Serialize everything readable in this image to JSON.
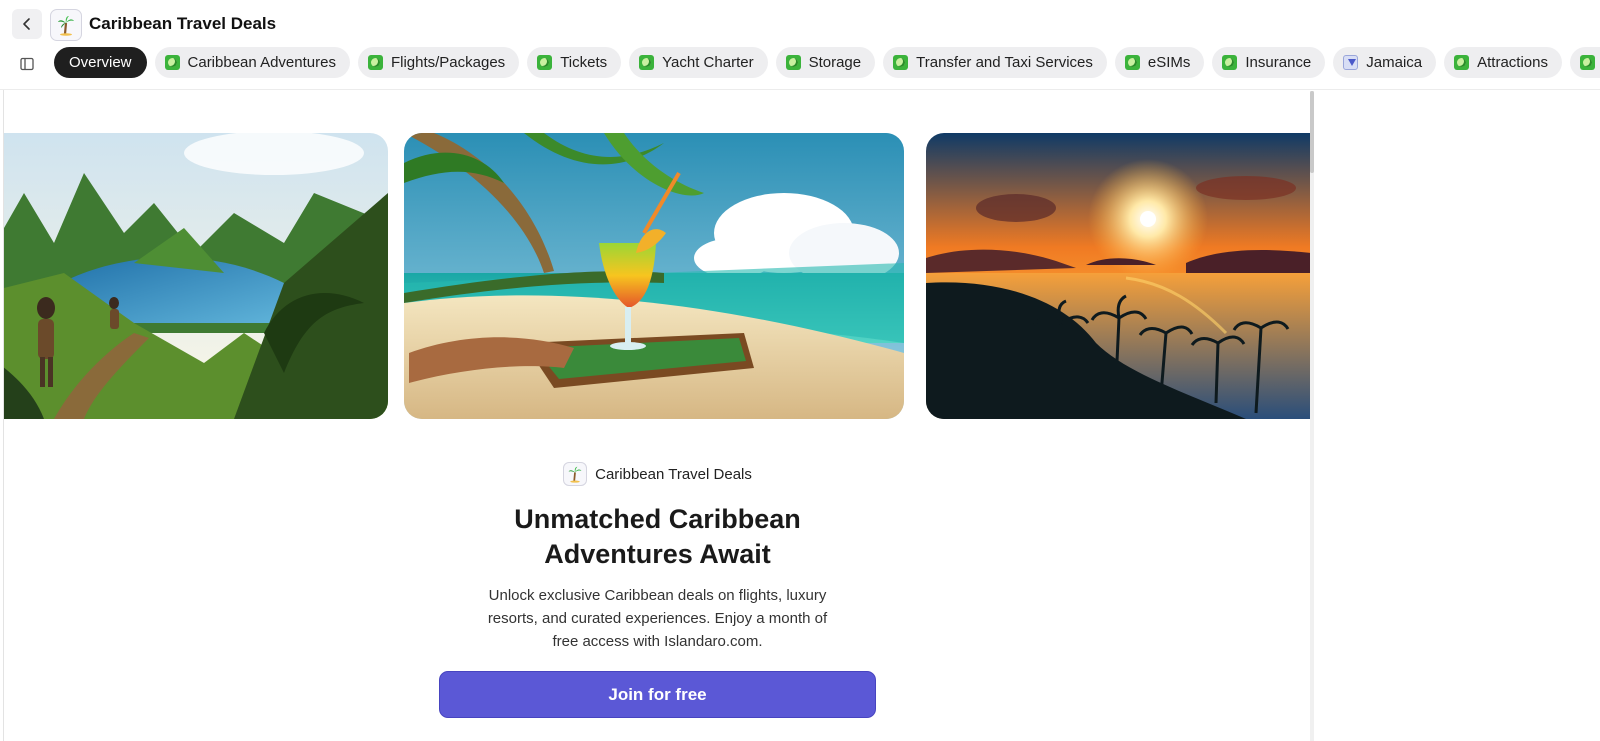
{
  "header": {
    "back_icon": "chevron-left-icon",
    "app_icon": "palm-tree-icon",
    "title": "Caribbean Travel Deals"
  },
  "tabs": [
    {
      "label": "Overview",
      "active": true,
      "icon": ""
    },
    {
      "label": "Caribbean Adventures",
      "icon": "green-app-icon"
    },
    {
      "label": "Flights/Packages",
      "icon": "green-app-icon"
    },
    {
      "label": "Tickets",
      "icon": "green-app-icon"
    },
    {
      "label": "Yacht Charter",
      "icon": "green-app-icon"
    },
    {
      "label": "Storage",
      "icon": "green-app-icon"
    },
    {
      "label": "Transfer and Taxi Services",
      "icon": "green-app-icon"
    },
    {
      "label": "eSIMs",
      "icon": "green-app-icon"
    },
    {
      "label": "Insurance",
      "icon": "green-app-icon"
    },
    {
      "label": "Jamaica",
      "icon": "blue-cursor-icon"
    },
    {
      "label": "Attractions",
      "icon": "green-app-icon"
    }
  ],
  "gallery": {
    "images": [
      {
        "name": "mountain-hikers-image"
      },
      {
        "name": "beach-cocktail-image"
      },
      {
        "name": "sunset-palms-image"
      }
    ]
  },
  "main": {
    "brand_name": "Caribbean Travel Deals",
    "headline": "Unmatched Caribbean Adventures Await",
    "description": "Unlock exclusive Caribbean deals on flights, luxury resorts, and curated experiences. Enjoy a month of free access with Islandaro.com.",
    "cta_label": "Join for free"
  },
  "colors": {
    "accent": "#5b58d6",
    "active_tab": "#1f1f1f",
    "tab_bg": "#eeeef0"
  }
}
